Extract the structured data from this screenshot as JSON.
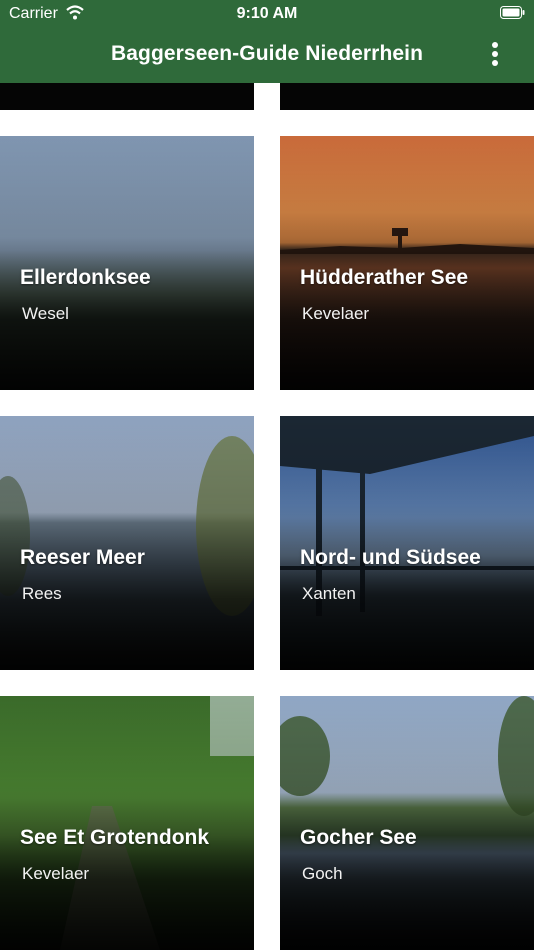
{
  "status": {
    "carrier": "Carrier",
    "time": "9:10 AM"
  },
  "header": {
    "title": "Baggerseen-Guide Niederrhein",
    "menu_icon": "more-vertical-icon"
  },
  "colors": {
    "bar": "#2f6a3a",
    "card_text": "#ffffff"
  },
  "lakes": [
    {
      "name": "Ellerdonksee",
      "town": "Wesel"
    },
    {
      "name": "Hüdderather See",
      "town": "Kevelaer"
    },
    {
      "name": "Reeser Meer",
      "town": "Rees"
    },
    {
      "name": "Nord- und Südsee",
      "town": "Xanten"
    },
    {
      "name": "See Et Grotendonk",
      "town": "Kevelaer"
    },
    {
      "name": "Gocher See",
      "town": "Goch"
    }
  ]
}
